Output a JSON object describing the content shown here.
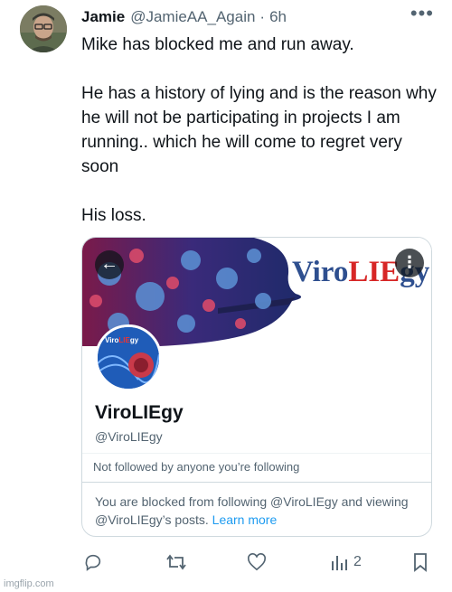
{
  "author": {
    "name": "Jamie",
    "handle": "@JamieAA_Again",
    "separator": "·",
    "time": "6h",
    "avatar_icon": "user-photo"
  },
  "tweet": {
    "lines": [
      "Mike has blocked me and run away.",
      "He has a history of lying and is the reason why he will not be participating in projects I am running.. which he will come to regret very soon",
      "His loss."
    ]
  },
  "card": {
    "banner_title_prefix": "Viro",
    "banner_title_highlight": "LIE",
    "banner_title_suffix": "gy",
    "profile_pic_label_prefix": "Viro",
    "profile_pic_label_highlight": "LIE",
    "profile_pic_label_suffix": "gy",
    "display_name": "ViroLIEgy",
    "handle": "@ViroLIEgy",
    "follow_info": "Not followed by anyone you’re following",
    "blocked_message": "You are blocked from following @ViroLIEgy and viewing @ViroLIEgy’s posts.",
    "learn_more": "Learn more",
    "back_icon": "arrow-left",
    "menu_icon": "more-vertical"
  },
  "actions": {
    "reply_icon": "reply",
    "retweet_icon": "retweet",
    "like_icon": "heart",
    "views_icon": "bar-chart",
    "views_count": "2",
    "bookmark_icon": "bookmark"
  },
  "watermark": "imgflip.com",
  "colors": {
    "text": "#0f1419",
    "muted": "#536471",
    "link": "#1d9bf0",
    "border": "#cfd9de",
    "banner_title": "#2e4f8f",
    "banner_highlight": "#d72626"
  }
}
